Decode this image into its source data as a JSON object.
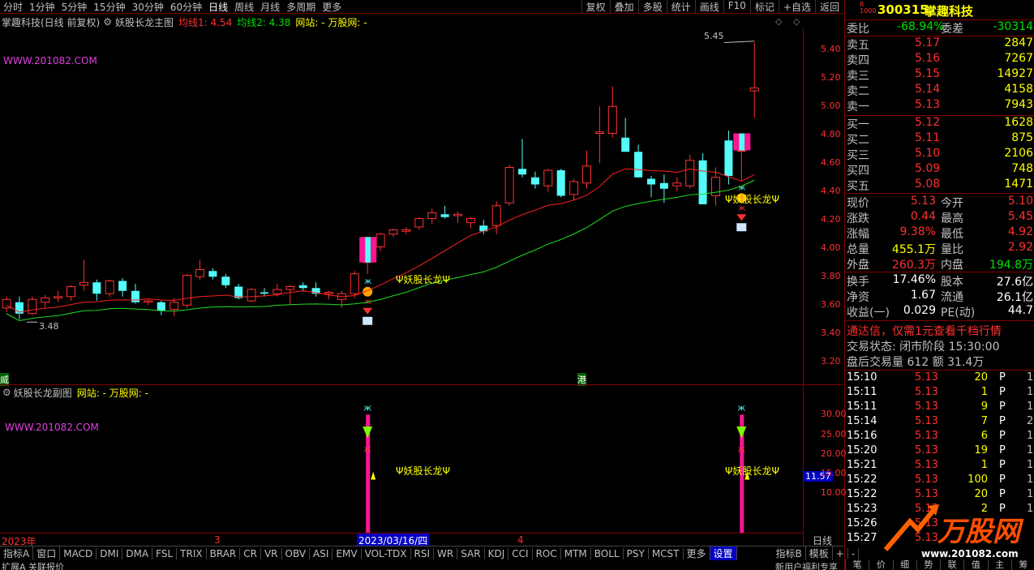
{
  "top_tabs": [
    "分时",
    "1分钟",
    "5分钟",
    "15分钟",
    "30分钟",
    "60分钟",
    "日线",
    "周线",
    "月线",
    "多周期",
    "更多"
  ],
  "selected_tab": "日线",
  "toolbar_right": [
    "复权",
    "叠加",
    "多股",
    "统计",
    "画线",
    "F10",
    "标记",
    "+自选",
    "返回"
  ],
  "main_header": {
    "title": "掌趣科技(日线 前复权)",
    "indicator": "妖股长龙主图",
    "ma1": "均线1: 4.54",
    "ma2": "均线2: 4.38",
    "site": "网站: - 万股网: -"
  },
  "watermark_url": "WWW.201082.COM",
  "price_axis": [
    "5.40",
    "5.20",
    "5.00",
    "4.80",
    "4.60",
    "4.40",
    "4.20",
    "4.00",
    "3.80",
    "3.60",
    "3.40",
    "3.20"
  ],
  "high_label": "5.45",
  "low_label": "3.48",
  "signal_label": "Ψ妖股长龙Ψ",
  "sub_header": {
    "indicator": "妖股长龙副图",
    "site": "网站: - 万股网: -"
  },
  "sub_axis": [
    "30.00",
    "25.00",
    "20.00",
    "15.00",
    "10.00"
  ],
  "sub_current": "11.57",
  "date_axis": {
    "year": "2023年",
    "m3": "3",
    "cursor": "2023/03/16/四",
    "m4": "4",
    "period": "日线"
  },
  "left_markers": {
    "a": "威",
    "b": "港"
  },
  "bottom_tabs": [
    "指标A",
    "窗口",
    "MACD",
    "DMI",
    "DMA",
    "FSL",
    "TRIX",
    "BRAR",
    "CR",
    "VR",
    "OBV",
    "ASI",
    "EMV",
    "VOL-TDX",
    "RSI",
    "WR",
    "SAR",
    "KDJ",
    "CCI",
    "ROC",
    "MTM",
    "BOLL",
    "PSY",
    "MCST",
    "更多",
    "设置",
    "指标B",
    "模板",
    "+",
    "-"
  ],
  "footer": {
    "left": "扩展A 关联报价",
    "right": "新用户福利专享"
  },
  "quote": {
    "code": "300315",
    "name": "掌趣科技",
    "weibi_label": "委比",
    "weibi": "-68.94%",
    "weicha_label": "委差",
    "weicha": "-30314",
    "asks": [
      {
        "label": "卖五",
        "price": "5.17",
        "vol": "2847"
      },
      {
        "label": "卖四",
        "price": "5.16",
        "vol": "7267"
      },
      {
        "label": "卖三",
        "price": "5.15",
        "vol": "14927"
      },
      {
        "label": "卖二",
        "price": "5.14",
        "vol": "4158"
      },
      {
        "label": "卖一",
        "price": "5.13",
        "vol": "7943"
      }
    ],
    "bids": [
      {
        "label": "买一",
        "price": "5.12",
        "vol": "1628"
      },
      {
        "label": "买二",
        "price": "5.11",
        "vol": "875"
      },
      {
        "label": "买三",
        "price": "5.10",
        "vol": "2106"
      },
      {
        "label": "买四",
        "price": "5.09",
        "vol": "748"
      },
      {
        "label": "买五",
        "price": "5.08",
        "vol": "1471"
      }
    ],
    "stats": [
      {
        "l1": "现价",
        "v1": "5.13",
        "l2": "今开",
        "v2": "5.10"
      },
      {
        "l1": "涨跌",
        "v1": "0.44",
        "l2": "最高",
        "v2": "5.45"
      },
      {
        "l1": "涨幅",
        "v1": "9.38%",
        "l2": "最低",
        "v2": "4.92"
      },
      {
        "l1": "总量",
        "v1": "455.1万",
        "l2": "量比",
        "v2": "2.92"
      },
      {
        "l1": "外盘",
        "v1": "260.3万",
        "l2": "内盘",
        "v2": "194.8万"
      }
    ],
    "stats2": [
      {
        "l1": "换手",
        "v1": "17.46%",
        "l2": "股本",
        "v2": "27.6亿"
      },
      {
        "l1": "净资",
        "v1": "1.67",
        "l2": "流通",
        "v2": "26.1亿"
      },
      {
        "l1": "收益(一)",
        "v1": "0.029",
        "l2": "PE(动)",
        "v2": "44.7"
      }
    ],
    "promo": "通达信，仅需1元查看千档行情",
    "trade_state": "交易状态: 闭市阶段 15:30:00",
    "after_hours": "盘后交易量 612 额 31.4万",
    "ticks": [
      {
        "t": "15:10",
        "p": "5.13",
        "v": "20",
        "d": "P",
        "n": "1"
      },
      {
        "t": "15:11",
        "p": "5.13",
        "v": "1",
        "d": "P",
        "n": "1"
      },
      {
        "t": "15:11",
        "p": "5.13",
        "v": "9",
        "d": "P",
        "n": "1"
      },
      {
        "t": "15:14",
        "p": "5.13",
        "v": "7",
        "d": "P",
        "n": "2"
      },
      {
        "t": "15:16",
        "p": "5.13",
        "v": "6",
        "d": "P",
        "n": "1"
      },
      {
        "t": "15:20",
        "p": "5.13",
        "v": "19",
        "d": "P",
        "n": "1"
      },
      {
        "t": "15:21",
        "p": "5.13",
        "v": "1",
        "d": "P",
        "n": "1"
      },
      {
        "t": "15:22",
        "p": "5.13",
        "v": "100",
        "d": "P",
        "n": "1"
      },
      {
        "t": "15:22",
        "p": "5.13",
        "v": "20",
        "d": "P",
        "n": "1"
      },
      {
        "t": "15:23",
        "p": "5.13",
        "v": "2",
        "d": "P",
        "n": "1"
      },
      {
        "t": "15:26",
        "p": "5.13",
        "v": "",
        "d": "",
        "n": ""
      },
      {
        "t": "15:27",
        "p": "5.13",
        "v": "",
        "d": "",
        "n": ""
      }
    ],
    "bottom_tabs": [
      "笔",
      "价",
      "细",
      "势",
      "联",
      "值",
      "主",
      "筹"
    ],
    "logo_text": "万股网",
    "logo_url": "www.201082.com"
  },
  "chart_data": {
    "type": "candlestick",
    "ylim": [
      3.15,
      5.55
    ],
    "candles": [
      [
        3.58,
        3.66,
        3.55,
        3.64
      ],
      [
        3.62,
        3.66,
        3.5,
        3.54
      ],
      [
        3.54,
        3.66,
        3.53,
        3.64
      ],
      [
        3.62,
        3.67,
        3.58,
        3.65
      ],
      [
        3.65,
        3.7,
        3.62,
        3.66
      ],
      [
        3.66,
        3.74,
        3.63,
        3.73
      ],
      [
        3.74,
        3.92,
        3.7,
        3.76
      ],
      [
        3.76,
        3.78,
        3.63,
        3.68
      ],
      [
        3.68,
        3.78,
        3.66,
        3.77
      ],
      [
        3.77,
        3.79,
        3.66,
        3.7
      ],
      [
        3.7,
        3.75,
        3.61,
        3.62
      ],
      [
        3.62,
        3.64,
        3.6,
        3.63
      ],
      [
        3.62,
        3.63,
        3.53,
        3.56
      ],
      [
        3.57,
        3.65,
        3.52,
        3.62
      ],
      [
        3.6,
        3.82,
        3.58,
        3.81
      ],
      [
        3.8,
        3.92,
        3.78,
        3.85
      ],
      [
        3.84,
        3.86,
        3.78,
        3.8
      ],
      [
        3.8,
        3.82,
        3.72,
        3.74
      ],
      [
        3.73,
        3.75,
        3.64,
        3.65
      ],
      [
        3.63,
        3.72,
        3.62,
        3.71
      ],
      [
        3.69,
        3.72,
        3.66,
        3.68
      ],
      [
        3.68,
        3.75,
        3.66,
        3.71
      ],
      [
        3.71,
        3.74,
        3.6,
        3.73
      ],
      [
        3.74,
        3.76,
        3.7,
        3.72
      ],
      [
        3.72,
        3.76,
        3.66,
        3.68
      ],
      [
        3.68,
        3.7,
        3.64,
        3.69
      ],
      [
        3.64,
        3.7,
        3.58,
        3.68
      ],
      [
        3.68,
        3.84,
        3.65,
        3.82
      ],
      [
        3.9,
        4.01,
        3.82,
        4.0
      ],
      [
        4.01,
        4.11,
        3.98,
        4.1
      ],
      [
        4.1,
        4.14,
        4.08,
        4.13
      ],
      [
        4.12,
        4.15,
        4.1,
        4.13
      ],
      [
        4.15,
        4.22,
        4.13,
        4.21
      ],
      [
        4.21,
        4.28,
        4.17,
        4.25
      ],
      [
        4.24,
        4.3,
        4.21,
        4.22
      ],
      [
        4.23,
        4.26,
        4.18,
        4.24
      ],
      [
        4.18,
        4.22,
        4.14,
        4.21
      ],
      [
        4.16,
        4.2,
        4.1,
        4.12
      ],
      [
        4.16,
        4.33,
        4.1,
        4.3
      ],
      [
        4.32,
        4.59,
        4.3,
        4.57
      ],
      [
        4.56,
        4.77,
        4.5,
        4.52
      ],
      [
        4.5,
        4.54,
        4.42,
        4.45
      ],
      [
        4.44,
        4.56,
        4.4,
        4.55
      ],
      [
        4.55,
        4.56,
        4.36,
        4.37
      ],
      [
        4.38,
        4.49,
        4.34,
        4.47
      ],
      [
        4.46,
        4.69,
        4.42,
        4.58
      ],
      [
        4.81,
        5.0,
        4.6,
        4.82
      ],
      [
        4.81,
        5.14,
        4.78,
        5.0
      ],
      [
        4.78,
        4.92,
        4.7,
        4.68
      ],
      [
        4.68,
        4.73,
        4.5,
        4.5
      ],
      [
        4.49,
        4.51,
        4.36,
        4.45
      ],
      [
        4.46,
        4.52,
        4.32,
        4.42
      ],
      [
        4.44,
        4.5,
        4.4,
        4.46
      ],
      [
        4.44,
        4.66,
        4.42,
        4.62
      ],
      [
        4.62,
        4.67,
        4.31,
        4.31
      ],
      [
        4.37,
        4.57,
        4.3,
        4.5
      ],
      [
        4.76,
        4.83,
        4.45,
        4.51
      ],
      [
        4.69,
        4.8,
        4.48,
        4.69
      ],
      [
        5.11,
        5.45,
        4.92,
        5.13
      ]
    ]
  }
}
